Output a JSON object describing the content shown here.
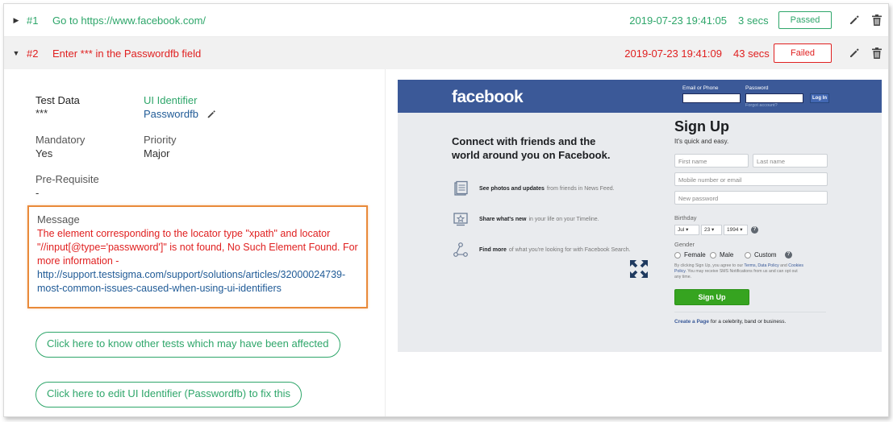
{
  "steps": [
    {
      "number": "#1",
      "title": "Go to https://www.facebook.com/",
      "timestamp": "2019-07-23 19:41:05",
      "duration": "3 secs",
      "status": "Passed",
      "expanded": false
    },
    {
      "number": "#2",
      "title": "Enter *** in the Passwordfb field",
      "timestamp": "2019-07-23 19:41:09",
      "duration": "43 secs",
      "status": "Failed",
      "expanded": true
    }
  ],
  "detail": {
    "test_data_label": "Test Data",
    "test_data_value": "***",
    "ui_identifier_label": "UI Identifier",
    "ui_identifier_value": "Passwordfb",
    "mandatory_label": "Mandatory",
    "mandatory_value": "Yes",
    "priority_label": "Priority",
    "priority_value": "Major",
    "prerequisite_label": "Pre-Requisite",
    "prerequisite_value": "-",
    "message_label": "Message",
    "message_text": "The element corresponding to the locator type \"xpath\" and locator \"//input[@type='passwword']\" is not found, No Such Element Found. For more information -",
    "message_link": "http://support.testsigma.com/support/solutions/articles/32000024739-most-common-issues-caused-when-using-ui-identifiers",
    "affected_tests_button": "Click here to know other tests which may have been affected",
    "edit_identifier_button": "Click here to edit UI Identifier (Passwordfb) to fix this"
  },
  "screenshot": {
    "logo": "facebook",
    "email_label": "Email or Phone",
    "password_label": "Password",
    "login_button": "Log In",
    "forgot": "Forgot account?",
    "connect_text": "Connect with friends and the world around you on Facebook.",
    "features": [
      {
        "bold": "See photos and updates",
        "rest": "from friends in News Feed."
      },
      {
        "bold": "Share what's new",
        "rest": "in your life on your Timeline."
      },
      {
        "bold": "Find more",
        "rest": "of what you're looking for with Facebook Search."
      }
    ],
    "signup_title": "Sign Up",
    "signup_sub": "It's quick and easy.",
    "first_name": "First name",
    "last_name": "Last name",
    "mobile": "Mobile number or email",
    "new_password": "New password",
    "birthday_label": "Birthday",
    "birthday_month": "Jul",
    "birthday_day": "23",
    "birthday_year": "1994",
    "gender_label": "Gender",
    "gender_female": "Female",
    "gender_male": "Male",
    "gender_custom": "Custom",
    "terms_pre": "By clicking Sign Up, you agree to our",
    "terms_link1": "Terms, Data Policy",
    "terms_mid": "and",
    "terms_link2": "Cookies Policy",
    "terms_post": ". You may receive SMS Notifications from us and can opt out any time.",
    "signup_button": "Sign Up",
    "create_page_link": "Create a Page",
    "create_page_rest": "for a celebrity, band or business."
  },
  "colors": {
    "passed": "#2ea66a",
    "failed": "#e02020",
    "link": "#1f5a96",
    "message_border": "#e98a3a",
    "facebook_blue": "#3b5998"
  }
}
